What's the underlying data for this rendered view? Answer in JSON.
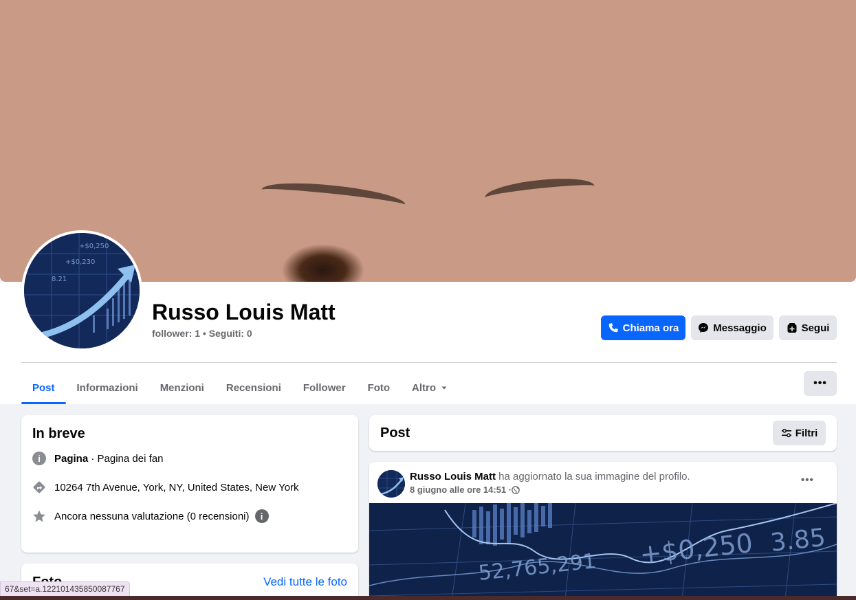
{
  "page": {
    "name": "Russo Louis Matt",
    "stats": "follower: 1 • Seguiti: 0"
  },
  "actions": {
    "call": "Chiama ora",
    "message": "Messaggio",
    "follow": "Segui"
  },
  "tabs": [
    "Post",
    "Informazioni",
    "Menzioni",
    "Recensioni",
    "Follower",
    "Foto",
    "Altro"
  ],
  "intro": {
    "title": "In breve",
    "category_bold": "Pagina",
    "category_rest": " · Pagina dei fan",
    "address": "10264 7th Avenue, York, NY, United States, New York",
    "rating": "Ancora nessuna valutazione (0 recensioni)"
  },
  "photos": {
    "title": "Foto",
    "see_all": "Vedi tutte le foto"
  },
  "posts_header": {
    "title": "Post",
    "filters": "Filtri"
  },
  "post": {
    "author": "Russo Louis Matt",
    "action": " ha aggiornato la sua immagine del profilo.",
    "date": "8 giugno alle ore 14:51 · ",
    "image_texts": [
      "+$0,250",
      "3.85",
      "52,765,291"
    ]
  },
  "status_bar": "67&set=a.122101435850087767",
  "colors": {
    "accent": "#0866ff",
    "secondary_button": "#e4e6eb",
    "muted_text": "#65676b",
    "page_bg": "#f0f2f5"
  }
}
